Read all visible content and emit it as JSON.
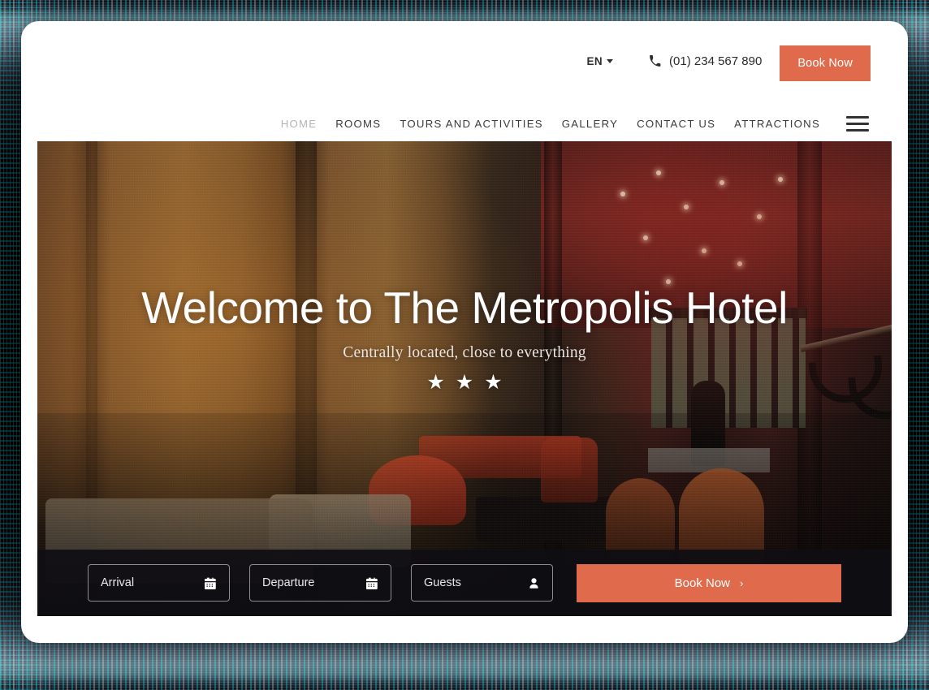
{
  "header": {
    "language": {
      "label": "EN",
      "icon": "chevron-down-icon"
    },
    "phone": {
      "icon": "phone-icon",
      "number": "(01) 234 567 890"
    },
    "book_now_label": "Book Now"
  },
  "nav": {
    "items": [
      {
        "label": "HOME",
        "active": true
      },
      {
        "label": "ROOMS",
        "active": false
      },
      {
        "label": "TOURS AND ACTIVITIES",
        "active": false
      },
      {
        "label": "GALLERY",
        "active": false
      },
      {
        "label": "CONTACT US",
        "active": false
      },
      {
        "label": "ATTRACTIONS",
        "active": false
      }
    ],
    "menu_icon": "hamburger-menu-icon"
  },
  "hero": {
    "title": "Welcome to The Metropolis Hotel",
    "subtitle": "Centrally located, close to everything",
    "star_rating": 3,
    "star_glyph": "★"
  },
  "booking": {
    "arrival": {
      "placeholder": "Arrival",
      "icon": "calendar-icon"
    },
    "departure": {
      "placeholder": "Departure",
      "icon": "calendar-icon"
    },
    "guests": {
      "placeholder": "Guests",
      "icon": "person-icon"
    },
    "cta_label": "Book Now",
    "cta_chevron": "›"
  },
  "colors": {
    "accent": "#e06b4c",
    "nav_text": "#3a3a3a",
    "nav_active": "#b4b4b4",
    "bookbar_bg": "#0f0e13",
    "frame": "#ffffff"
  }
}
